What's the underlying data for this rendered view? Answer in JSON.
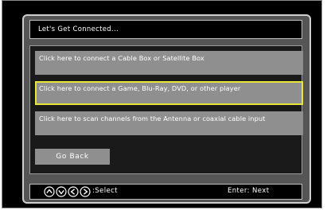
{
  "dialog": {
    "title": "Let's Get Connected..."
  },
  "menu": {
    "options": [
      {
        "label": "Click here to connect a Cable Box or Satellite Box"
      },
      {
        "label": "Click here to connect a Game, Blu-Ray, DVD, or other player",
        "selected": true
      },
      {
        "label": "Click here to scan channels from the Antenna or coaxial cable input"
      }
    ],
    "go_back_label": "Go Back"
  },
  "footer": {
    "nav_icons": [
      "up-arrow-icon",
      "down-arrow-icon",
      "left-arrow-icon",
      "right-arrow-icon"
    ],
    "select_label": ":Select",
    "enter_label": "Enter: Next"
  },
  "colors": {
    "highlight": "#e8e43a",
    "button_gray": "#8f8f8f",
    "panel_gray": "#555555"
  }
}
